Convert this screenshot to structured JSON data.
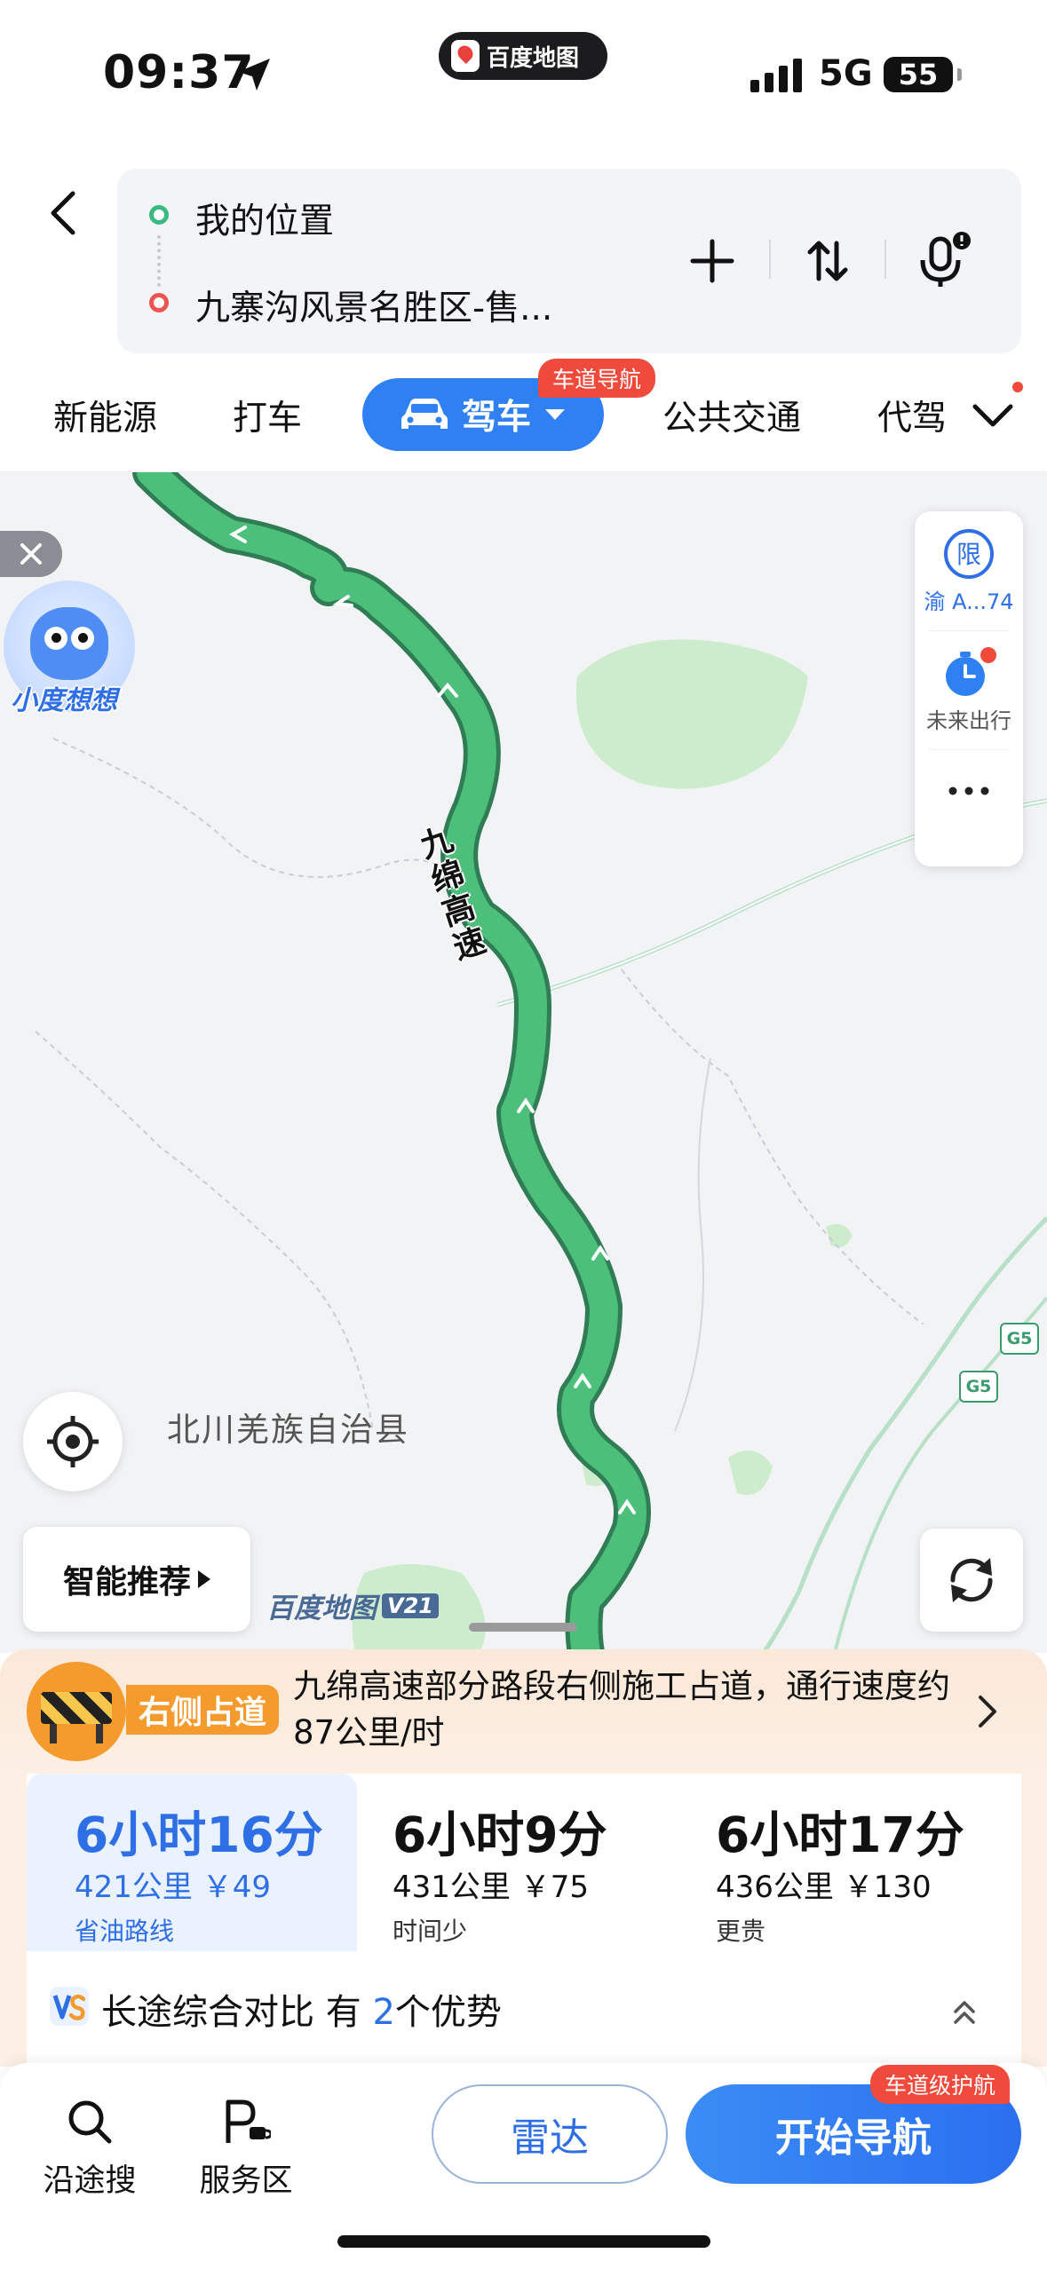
{
  "status_bar": {
    "time": "09:37",
    "app_name": "百度地图",
    "network": "5G",
    "battery": "55"
  },
  "route": {
    "origin": "我的位置",
    "destination": "九寨沟风景名胜区-售..."
  },
  "modes": {
    "new_energy": "新能源",
    "taxi": "打车",
    "drive": "驾车",
    "drive_badge": "车道导航",
    "transit": "公共交通",
    "chauffeur": "代驾"
  },
  "map": {
    "road_label": "九绵高速",
    "county_label": "北川羌族自治县",
    "assistant_label": "小度想想",
    "plate_label": "渝 A...74",
    "restrict_icon_text": "限",
    "future_trip_label": "未来出行",
    "smart_recommend": "智能推荐",
    "watermark": "百度地图",
    "watermark_version": "V21",
    "highway_shield": "G5"
  },
  "alert": {
    "tag": "右侧占道",
    "text": "九绵高速部分路段右侧施工占道，通行速度约87公里/时"
  },
  "routes": [
    {
      "time": "6小时16分",
      "meta": "421公里 ￥49",
      "tag": "省油路线"
    },
    {
      "time": "6小时9分",
      "meta": "431公里 ￥75",
      "tag": "时间少"
    },
    {
      "time": "6小时17分",
      "meta": "436公里 ￥130",
      "tag": "更贵"
    }
  ],
  "compare": {
    "prefix": "长途综合对比 有",
    "count": "2",
    "suffix": "个优势"
  },
  "actions": {
    "search_along": "沿途搜",
    "service_area": "服务区",
    "radar": "雷达",
    "start_nav": "开始导航",
    "start_badge": "车道级护航"
  },
  "colors": {
    "accent": "#2f80f2",
    "route_green": "#3bb46e",
    "alert_orange": "#f59a2d",
    "badge_red": "#ef4a3c"
  }
}
